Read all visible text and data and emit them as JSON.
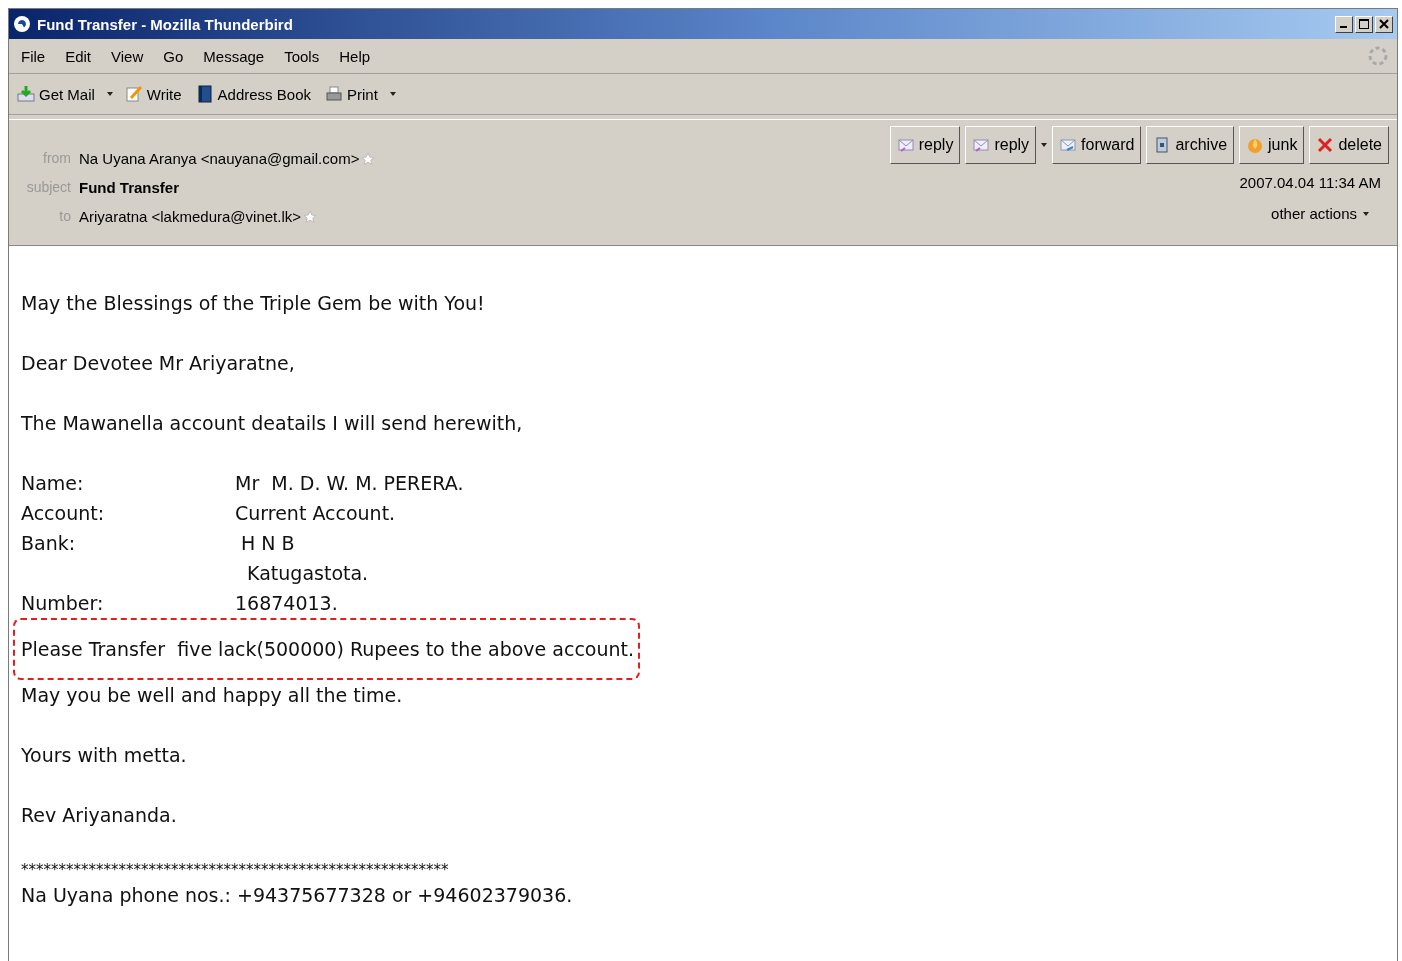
{
  "window": {
    "title": "Fund Transfer - Mozilla Thunderbird"
  },
  "menu": [
    "File",
    "Edit",
    "View",
    "Go",
    "Message",
    "Tools",
    "Help"
  ],
  "toolbar": [
    {
      "label": "Get Mail",
      "dropdown": true
    },
    {
      "label": "Write",
      "dropdown": false
    },
    {
      "label": "Address Book",
      "dropdown": false
    },
    {
      "label": "Print",
      "dropdown": true
    }
  ],
  "header": {
    "fields": [
      {
        "label": "from",
        "value": "Na Uyana Aranya <nauyana@gmail.com>",
        "kind": "address"
      },
      {
        "label": "subject",
        "value": "Fund Transfer",
        "kind": "subject"
      },
      {
        "label": "to",
        "value": "Ariyaratna <lakmedura@vinet.lk>",
        "kind": "address"
      }
    ],
    "actions": [
      {
        "label": "reply",
        "dropdown": false
      },
      {
        "label": "reply",
        "dropdown": true
      },
      {
        "label": "forward",
        "dropdown": false
      },
      {
        "label": "archive",
        "dropdown": false
      },
      {
        "label": "junk",
        "dropdown": false
      },
      {
        "label": "delete",
        "dropdown": false
      }
    ],
    "date": "2007.04.04 11:34 AM",
    "other_actions": "other actions"
  },
  "body": [
    {
      "kind": "text",
      "text": "May the Blessings of the Triple Gem be with You!"
    },
    {
      "kind": "text",
      "text": "Dear Devotee Mr Ariyaratne,"
    },
    {
      "kind": "text",
      "text": "The Mawanella account deatails I will send herewith,"
    },
    {
      "kind": "fields",
      "rows": [
        {
          "label": "Name:",
          "value": "Mr  M. D. W. M. PERERA."
        },
        {
          "label": "Account:",
          "value": "Current Account."
        },
        {
          "label": "Bank:",
          "value": " H N B"
        },
        {
          "label": "",
          "value": "  Katugastota."
        },
        {
          "label": "Number:",
          "value": "16874013."
        }
      ]
    },
    {
      "kind": "highlight",
      "text": "Please Transfer  five lack(500000) Rupees to the above account."
    },
    {
      "kind": "text",
      "text": "May you be well and happy all the time."
    },
    {
      "kind": "text",
      "text": "Yours with metta."
    },
    {
      "kind": "text",
      "text": "Rev Ariyananda."
    },
    {
      "kind": "rule",
      "text": "*********************************************************"
    },
    {
      "kind": "tight",
      "text": "Na Uyana phone nos.: +94375677328 or +94602379036."
    }
  ]
}
